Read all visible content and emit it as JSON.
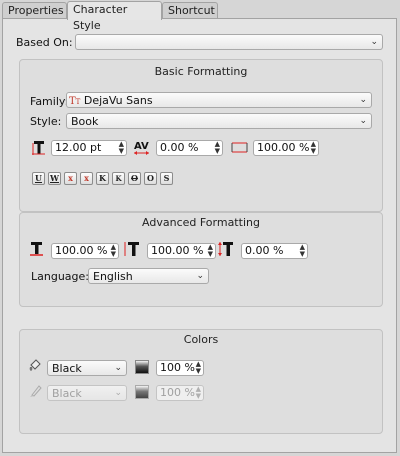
{
  "tabs": [
    "Properties",
    "Character Style",
    "Shortcut"
  ],
  "based_on": {
    "label": "Based On:",
    "value": ""
  },
  "basic": {
    "title": "Basic Formatting",
    "family_label": "Family:",
    "family_value": "DejaVu Sans",
    "style_label": "Style:",
    "style_value": "Book",
    "font_size": "12.00 pt",
    "kerning": "0.00 %",
    "scale": "100.00 %",
    "format_buttons": [
      "U",
      "W",
      "x",
      "x",
      "K",
      "K",
      "O",
      "O",
      "S"
    ]
  },
  "advanced": {
    "title": "Advanced Formatting",
    "height": "100.00 %",
    "width": "100.00 %",
    "offset": "0.00 %",
    "language_label": "Language:",
    "language_value": "English"
  },
  "colors": {
    "title": "Colors",
    "fill_color": "Black",
    "fill_shade": "100 %",
    "stroke_color": "Black",
    "stroke_shade": "100 %"
  }
}
